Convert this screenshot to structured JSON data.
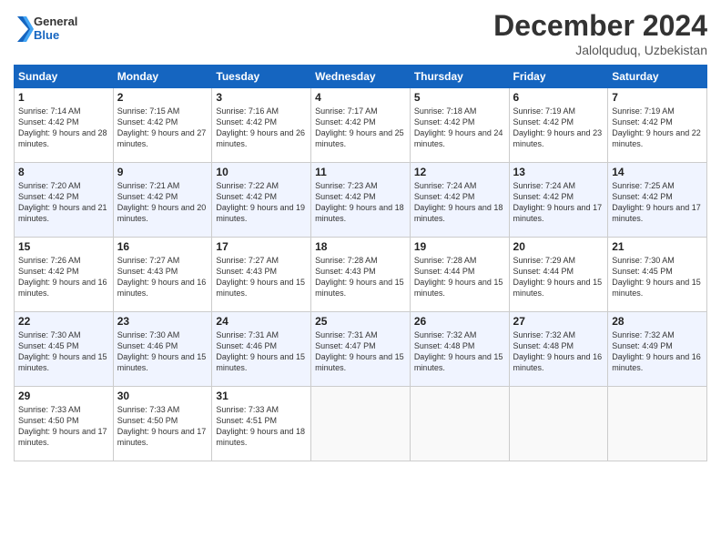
{
  "logo": {
    "general": "General",
    "blue": "Blue"
  },
  "header": {
    "month": "December 2024",
    "location": "Jalolquduq, Uzbekistan"
  },
  "weekdays": [
    "Sunday",
    "Monday",
    "Tuesday",
    "Wednesday",
    "Thursday",
    "Friday",
    "Saturday"
  ],
  "weeks": [
    [
      {
        "day": "1",
        "sunrise": "7:14 AM",
        "sunset": "4:42 PM",
        "daylight": "9 hours and 28 minutes."
      },
      {
        "day": "2",
        "sunrise": "7:15 AM",
        "sunset": "4:42 PM",
        "daylight": "9 hours and 27 minutes."
      },
      {
        "day": "3",
        "sunrise": "7:16 AM",
        "sunset": "4:42 PM",
        "daylight": "9 hours and 26 minutes."
      },
      {
        "day": "4",
        "sunrise": "7:17 AM",
        "sunset": "4:42 PM",
        "daylight": "9 hours and 25 minutes."
      },
      {
        "day": "5",
        "sunrise": "7:18 AM",
        "sunset": "4:42 PM",
        "daylight": "9 hours and 24 minutes."
      },
      {
        "day": "6",
        "sunrise": "7:19 AM",
        "sunset": "4:42 PM",
        "daylight": "9 hours and 23 minutes."
      },
      {
        "day": "7",
        "sunrise": "7:19 AM",
        "sunset": "4:42 PM",
        "daylight": "9 hours and 22 minutes."
      }
    ],
    [
      {
        "day": "8",
        "sunrise": "7:20 AM",
        "sunset": "4:42 PM",
        "daylight": "9 hours and 21 minutes."
      },
      {
        "day": "9",
        "sunrise": "7:21 AM",
        "sunset": "4:42 PM",
        "daylight": "9 hours and 20 minutes."
      },
      {
        "day": "10",
        "sunrise": "7:22 AM",
        "sunset": "4:42 PM",
        "daylight": "9 hours and 19 minutes."
      },
      {
        "day": "11",
        "sunrise": "7:23 AM",
        "sunset": "4:42 PM",
        "daylight": "9 hours and 18 minutes."
      },
      {
        "day": "12",
        "sunrise": "7:24 AM",
        "sunset": "4:42 PM",
        "daylight": "9 hours and 18 minutes."
      },
      {
        "day": "13",
        "sunrise": "7:24 AM",
        "sunset": "4:42 PM",
        "daylight": "9 hours and 17 minutes."
      },
      {
        "day": "14",
        "sunrise": "7:25 AM",
        "sunset": "4:42 PM",
        "daylight": "9 hours and 17 minutes."
      }
    ],
    [
      {
        "day": "15",
        "sunrise": "7:26 AM",
        "sunset": "4:42 PM",
        "daylight": "9 hours and 16 minutes."
      },
      {
        "day": "16",
        "sunrise": "7:27 AM",
        "sunset": "4:43 PM",
        "daylight": "9 hours and 16 minutes."
      },
      {
        "day": "17",
        "sunrise": "7:27 AM",
        "sunset": "4:43 PM",
        "daylight": "9 hours and 15 minutes."
      },
      {
        "day": "18",
        "sunrise": "7:28 AM",
        "sunset": "4:43 PM",
        "daylight": "9 hours and 15 minutes."
      },
      {
        "day": "19",
        "sunrise": "7:28 AM",
        "sunset": "4:44 PM",
        "daylight": "9 hours and 15 minutes."
      },
      {
        "day": "20",
        "sunrise": "7:29 AM",
        "sunset": "4:44 PM",
        "daylight": "9 hours and 15 minutes."
      },
      {
        "day": "21",
        "sunrise": "7:30 AM",
        "sunset": "4:45 PM",
        "daylight": "9 hours and 15 minutes."
      }
    ],
    [
      {
        "day": "22",
        "sunrise": "7:30 AM",
        "sunset": "4:45 PM",
        "daylight": "9 hours and 15 minutes."
      },
      {
        "day": "23",
        "sunrise": "7:30 AM",
        "sunset": "4:46 PM",
        "daylight": "9 hours and 15 minutes."
      },
      {
        "day": "24",
        "sunrise": "7:31 AM",
        "sunset": "4:46 PM",
        "daylight": "9 hours and 15 minutes."
      },
      {
        "day": "25",
        "sunrise": "7:31 AM",
        "sunset": "4:47 PM",
        "daylight": "9 hours and 15 minutes."
      },
      {
        "day": "26",
        "sunrise": "7:32 AM",
        "sunset": "4:48 PM",
        "daylight": "9 hours and 15 minutes."
      },
      {
        "day": "27",
        "sunrise": "7:32 AM",
        "sunset": "4:48 PM",
        "daylight": "9 hours and 16 minutes."
      },
      {
        "day": "28",
        "sunrise": "7:32 AM",
        "sunset": "4:49 PM",
        "daylight": "9 hours and 16 minutes."
      }
    ],
    [
      {
        "day": "29",
        "sunrise": "7:33 AM",
        "sunset": "4:50 PM",
        "daylight": "9 hours and 17 minutes."
      },
      {
        "day": "30",
        "sunrise": "7:33 AM",
        "sunset": "4:50 PM",
        "daylight": "9 hours and 17 minutes."
      },
      {
        "day": "31",
        "sunrise": "7:33 AM",
        "sunset": "4:51 PM",
        "daylight": "9 hours and 18 minutes."
      },
      null,
      null,
      null,
      null
    ]
  ],
  "labels": {
    "sunrise": "Sunrise:",
    "sunset": "Sunset:",
    "daylight": "Daylight:"
  }
}
